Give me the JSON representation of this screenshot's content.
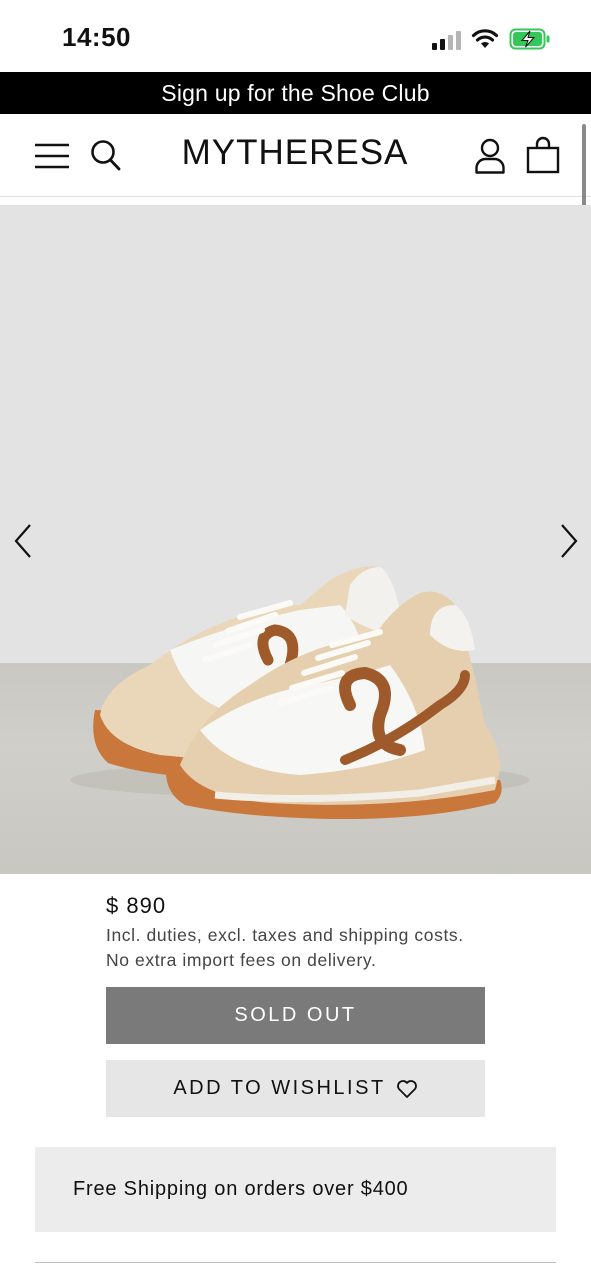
{
  "status_bar": {
    "time": "14:50"
  },
  "promo_banner": {
    "text": "Sign up for the Shoe Club"
  },
  "header": {
    "logo": "MYTHERESA",
    "icons": [
      "menu-icon",
      "search-icon",
      "account-icon",
      "shopping-bag-icon"
    ]
  },
  "gallery": {
    "image": "product-photo-sneakers",
    "prev_icon": "chevron-left-icon",
    "next_icon": "chevron-right-icon"
  },
  "product": {
    "price": "$ 890",
    "price_note_line1": "Incl. duties, excl. taxes and shipping costs.",
    "price_note_line2": "No extra import fees on delivery."
  },
  "actions": {
    "sold_out_label": "SOLD OUT",
    "wishlist_label": "ADD TO WISHLIST",
    "wishlist_icon": "heart-icon"
  },
  "shipping_banner": {
    "text": "Free Shipping on orders over $400"
  },
  "colors": {
    "banner_bg": "#000000",
    "sold_out_bg": "#7a7a7a",
    "wishlist_bg": "#e6e6e6",
    "shipping_bg": "#ececec",
    "battery_green": "#34c759"
  }
}
